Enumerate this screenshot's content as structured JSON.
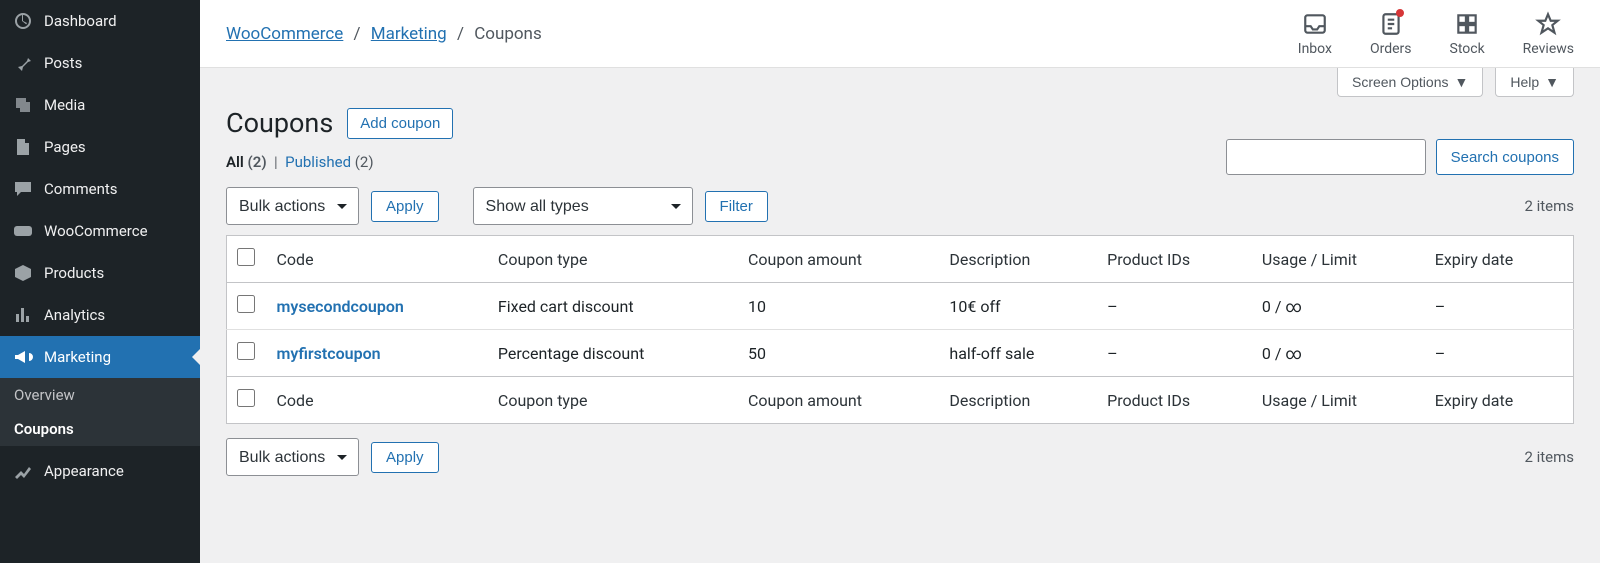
{
  "sidebar": {
    "items": [
      {
        "key": "dashboard",
        "label": "Dashboard"
      },
      {
        "key": "posts",
        "label": "Posts"
      },
      {
        "key": "media",
        "label": "Media"
      },
      {
        "key": "pages",
        "label": "Pages"
      },
      {
        "key": "comments",
        "label": "Comments"
      },
      {
        "key": "woocommerce",
        "label": "WooCommerce"
      },
      {
        "key": "products",
        "label": "Products"
      },
      {
        "key": "analytics",
        "label": "Analytics"
      },
      {
        "key": "marketing",
        "label": "Marketing"
      }
    ],
    "subitems": [
      {
        "label": "Overview",
        "current": false
      },
      {
        "label": "Coupons",
        "current": true
      }
    ],
    "trailing_label": "Appearance"
  },
  "breadcrumb": {
    "a": "WooCommerce",
    "b": "Marketing",
    "c": "Coupons"
  },
  "topbar": {
    "inbox": "Inbox",
    "orders": "Orders",
    "stock": "Stock",
    "reviews": "Reviews"
  },
  "screen_options": "Screen Options",
  "help": "Help",
  "page": {
    "title": "Coupons",
    "add": "Add coupon"
  },
  "filters": {
    "all_label": "All",
    "all_count": "(2)",
    "published_label": "Published",
    "published_count": "(2)"
  },
  "search": {
    "placeholder": "",
    "button": "Search coupons"
  },
  "bulk": {
    "label": "Bulk actions",
    "apply": "Apply"
  },
  "type_filter": {
    "label": "Show all types",
    "filter": "Filter"
  },
  "items_count": "2 items",
  "columns": {
    "code": "Code",
    "type": "Coupon type",
    "amount": "Coupon amount",
    "description": "Description",
    "product_ids": "Product IDs",
    "usage": "Usage / Limit",
    "expiry": "Expiry date"
  },
  "rows": [
    {
      "code": "mysecondcoupon",
      "type": "Fixed cart discount",
      "amount": "10",
      "description": "10€ off",
      "product_ids": "–",
      "usage": "0 / ∞",
      "expiry": "–"
    },
    {
      "code": "myfirstcoupon",
      "type": "Percentage discount",
      "amount": "50",
      "description": "half-off sale",
      "product_ids": "–",
      "usage": "0 / ∞",
      "expiry": "–"
    }
  ]
}
